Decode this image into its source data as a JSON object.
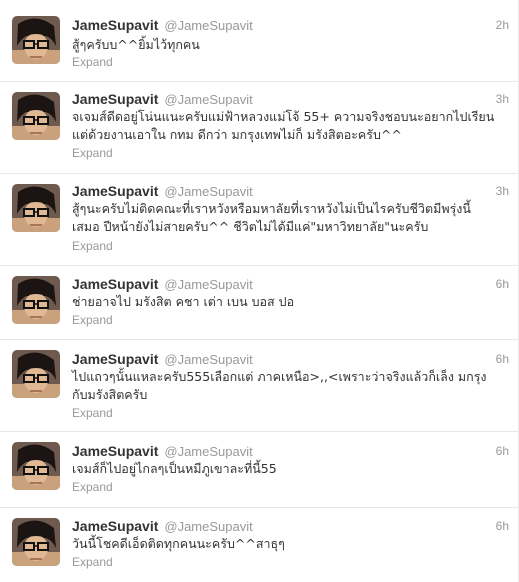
{
  "tweets": [
    {
      "fullname": "JameSupavit",
      "username": "@JameSupavit",
      "time": "2h",
      "text": "สู้ๆครับบ^^ยิ้มไว้ทุกคน",
      "expand": "Expand"
    },
    {
      "fullname": "JameSupavit",
      "username": "@JameSupavit",
      "time": "3h",
      "text": "จเจมส์ดีดอยู่โน่นแนะครับแม่ฟ้าหลวงแม่โจ้ 55+ ความจริงชอบนะอยากไปเรียน\nแต่ด้วยงานเอาใน กทม ดีกว่า มกรุงเทพไม่ก็ มรังสิตอะครับ^^",
      "expand": "Expand"
    },
    {
      "fullname": "JameSupavit",
      "username": "@JameSupavit",
      "time": "3h",
      "text": "สู้ๆนะครับไม่ติดคณะที่เราหวังหรือมหาลัยที่เราหวังไม่เป็นไรครับชีวิตมีพรุ่งนี้\nเสมอ ปีหน้ายังไม่สายครับ^^ ชีวิตไม่ได้มีแค่\"มหาวิทยาลัย\"นะครับ",
      "expand": "Expand"
    },
    {
      "fullname": "JameSupavit",
      "username": "@JameSupavit",
      "time": "6h",
      "text": "ช่ายอาจไป มรังสิต คชา เต่า เบน บอส ปอ",
      "expand": "Expand"
    },
    {
      "fullname": "JameSupavit",
      "username": "@JameSupavit",
      "time": "6h",
      "text": "ไปแถวๆนั้นแหละครับ555เลือกแต่ ภาคเหนือ>,,<เพราะว่าจริงแล้วก็เล็ง มกรุง\nกับมรังสิตครับ",
      "expand": "Expand"
    },
    {
      "fullname": "JameSupavit",
      "username": "@JameSupavit",
      "time": "6h",
      "text": "เจมส์ก็ไปอยู่ไกลๆเป็นหมีภูเขาละที่นี้55",
      "expand": "Expand"
    },
    {
      "fullname": "JameSupavit",
      "username": "@JameSupavit",
      "time": "6h",
      "text": "วันนี้โชคดีเอ็ดติดทุกคนนะครับ^^สาธุๆ",
      "expand": "Expand"
    }
  ]
}
